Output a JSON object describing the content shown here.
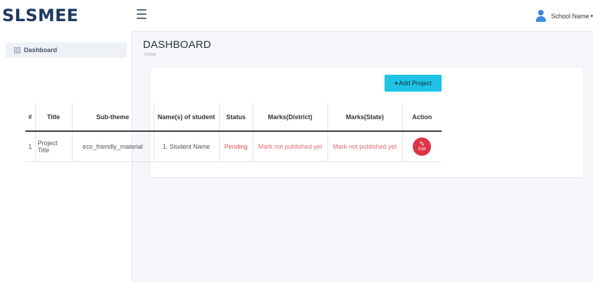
{
  "brand": "SLSMEE",
  "user": {
    "name": "School Name",
    "caret": "▾"
  },
  "sidebar": {
    "items": [
      {
        "label": "Dashboard"
      }
    ]
  },
  "page": {
    "title": "DASHBOARD",
    "breadcrumb": "Home"
  },
  "toolbar": {
    "add_label": "Add Project",
    "add_icon": "+"
  },
  "table": {
    "headers": [
      "#",
      "Title",
      "Sub-theme",
      "Name(s) of student",
      "Status",
      "Marks(District)",
      "Marks(State)",
      "Action"
    ],
    "rows": [
      {
        "num": "1",
        "title": "Project Title",
        "subtheme": "eco_friendly_material",
        "students": "1. Student Name",
        "status": "Pending",
        "marks_district": "Mark not published yet",
        "marks_state": "Mark not published yet",
        "action_label": "Edit",
        "action_icon": "✎"
      }
    ]
  },
  "colors": {
    "brand": "#1f3a5f",
    "accent": "#1ec3e6",
    "danger": "#dc3545",
    "pending": "#d9534f"
  }
}
